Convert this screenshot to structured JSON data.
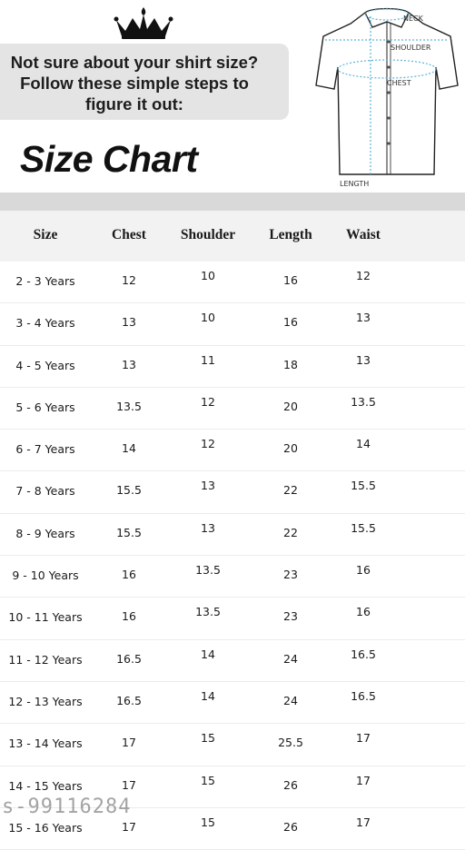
{
  "prompt": {
    "line1": "Not sure about your shirt size?",
    "line2": "Follow these simple steps to",
    "line3": "figure it out:"
  },
  "title": "Size Chart",
  "diagram_labels": {
    "neck": "NECK",
    "shoulder": "SHOULDER",
    "chest": "CHEST",
    "length": "LENGTH"
  },
  "table": {
    "headers": [
      "Size",
      "Chest",
      "Shoulder",
      "Length",
      "Waist"
    ],
    "rows": [
      [
        "2 - 3 Years",
        "12",
        "10",
        "16",
        "12"
      ],
      [
        "3 - 4 Years",
        "13",
        "10",
        "16",
        "13"
      ],
      [
        "4 - 5 Years",
        "13",
        "11",
        "18",
        "13"
      ],
      [
        "5 - 6 Years",
        "13.5",
        "12",
        "20",
        "13.5"
      ],
      [
        "6 - 7 Years",
        "14",
        "12",
        "20",
        "14"
      ],
      [
        "7 - 8 Years",
        "15.5",
        "13",
        "22",
        "15.5"
      ],
      [
        "8 - 9 Years",
        "15.5",
        "13",
        "22",
        "15.5"
      ],
      [
        "9 - 10 Years",
        "16",
        "13.5",
        "23",
        "16"
      ],
      [
        "10 - 11 Years",
        "16",
        "13.5",
        "23",
        "16"
      ],
      [
        "11 - 12 Years",
        "16.5",
        "14",
        "24",
        "16.5"
      ],
      [
        "12 - 13 Years",
        "16.5",
        "14",
        "24",
        "16.5"
      ],
      [
        "13 - 14 Years",
        "17",
        "15",
        "25.5",
        "17"
      ],
      [
        "14 - 15 Years",
        "17",
        "15",
        "26",
        "17"
      ],
      [
        "15 - 16 Years",
        "17",
        "15",
        "26",
        "17"
      ]
    ]
  },
  "watermark": "s-99116284",
  "colors": {
    "prompt_bg": "#e4e4e4",
    "header_bg": "#f2f2f2",
    "band": "#d9d9d9",
    "measure_line": "#5bb4d6"
  }
}
